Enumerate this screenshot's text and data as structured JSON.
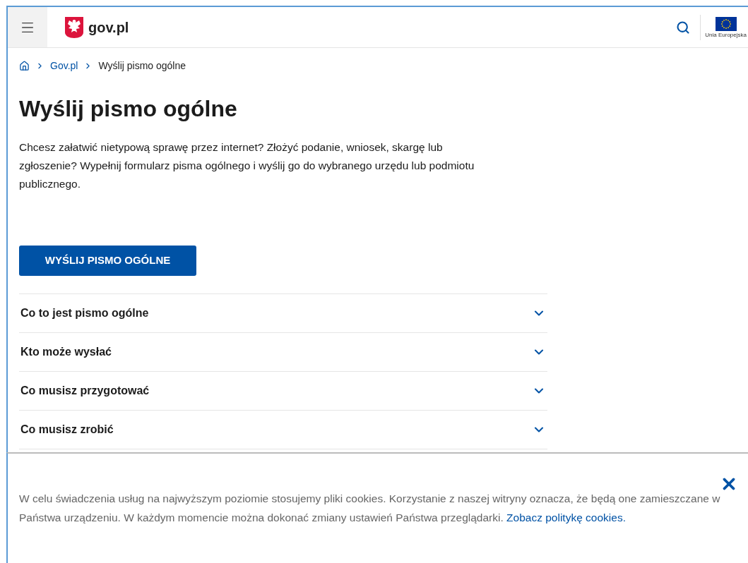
{
  "header": {
    "logo_text": "gov.pl",
    "eu_label": "Unia Europejska"
  },
  "breadcrumbs": [
    {
      "label": "Gov.pl",
      "kind": "link"
    },
    {
      "label": "Wyślij pismo ogólne",
      "kind": "current"
    }
  ],
  "title": "Wyślij pismo ogólne",
  "intro": "Chcesz załatwić nietypową sprawę przez internet? Złożyć podanie, wniosek, skargę lub zgłoszenie? Wypełnij formularz pisma ogólnego i wyślij go do wybranego urzędu lub podmiotu publicznego.",
  "cta_button": "WYŚLIJ PISMO OGÓLNE",
  "accordion": [
    {
      "label": "Co to jest pismo ogólne",
      "expanded": false
    },
    {
      "label": "Kto może wysłać",
      "expanded": false
    },
    {
      "label": "Co musisz przygotować",
      "expanded": false
    },
    {
      "label": "Co musisz zrobić",
      "expanded": false
    }
  ],
  "cookie_banner": {
    "text": "W celu świadczenia usług na najwyższym poziomie stosujemy pliki cookies. Korzystanie z naszej witryny oznacza, że będą one zamieszczane w Państwa urządzeniu. W każdym momencie można dokonać zmiany ustawień Państwa przeglądarki.",
    "link": "Zobacz politykę cookies."
  }
}
